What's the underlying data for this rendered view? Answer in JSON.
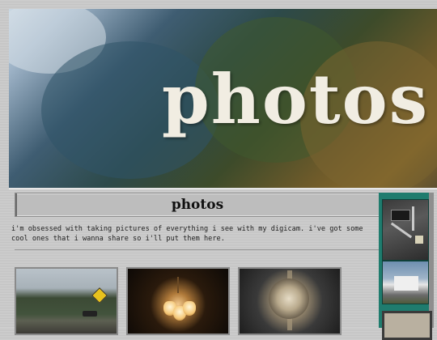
{
  "banner": {
    "title": "photos"
  },
  "page": {
    "heading": "photos",
    "intro": "i'm obsessed with taking pictures of everything i see with my digicam. i've got some cool ones that i wanna share so i'll put them here."
  },
  "gallery": {
    "thumbnails": [
      {
        "subject": "road-with-trees-and-sign"
      },
      {
        "subject": "chandelier-lights"
      },
      {
        "subject": "sun-ornament"
      }
    ]
  },
  "sidebar": {
    "thumbnails": [
      {
        "subject": "tools-on-board"
      },
      {
        "subject": "house-with-sky"
      },
      {
        "subject": "framed-picture"
      }
    ]
  },
  "colors": {
    "sidebar": "#1f7c6e",
    "background": "#c9c9c9"
  }
}
